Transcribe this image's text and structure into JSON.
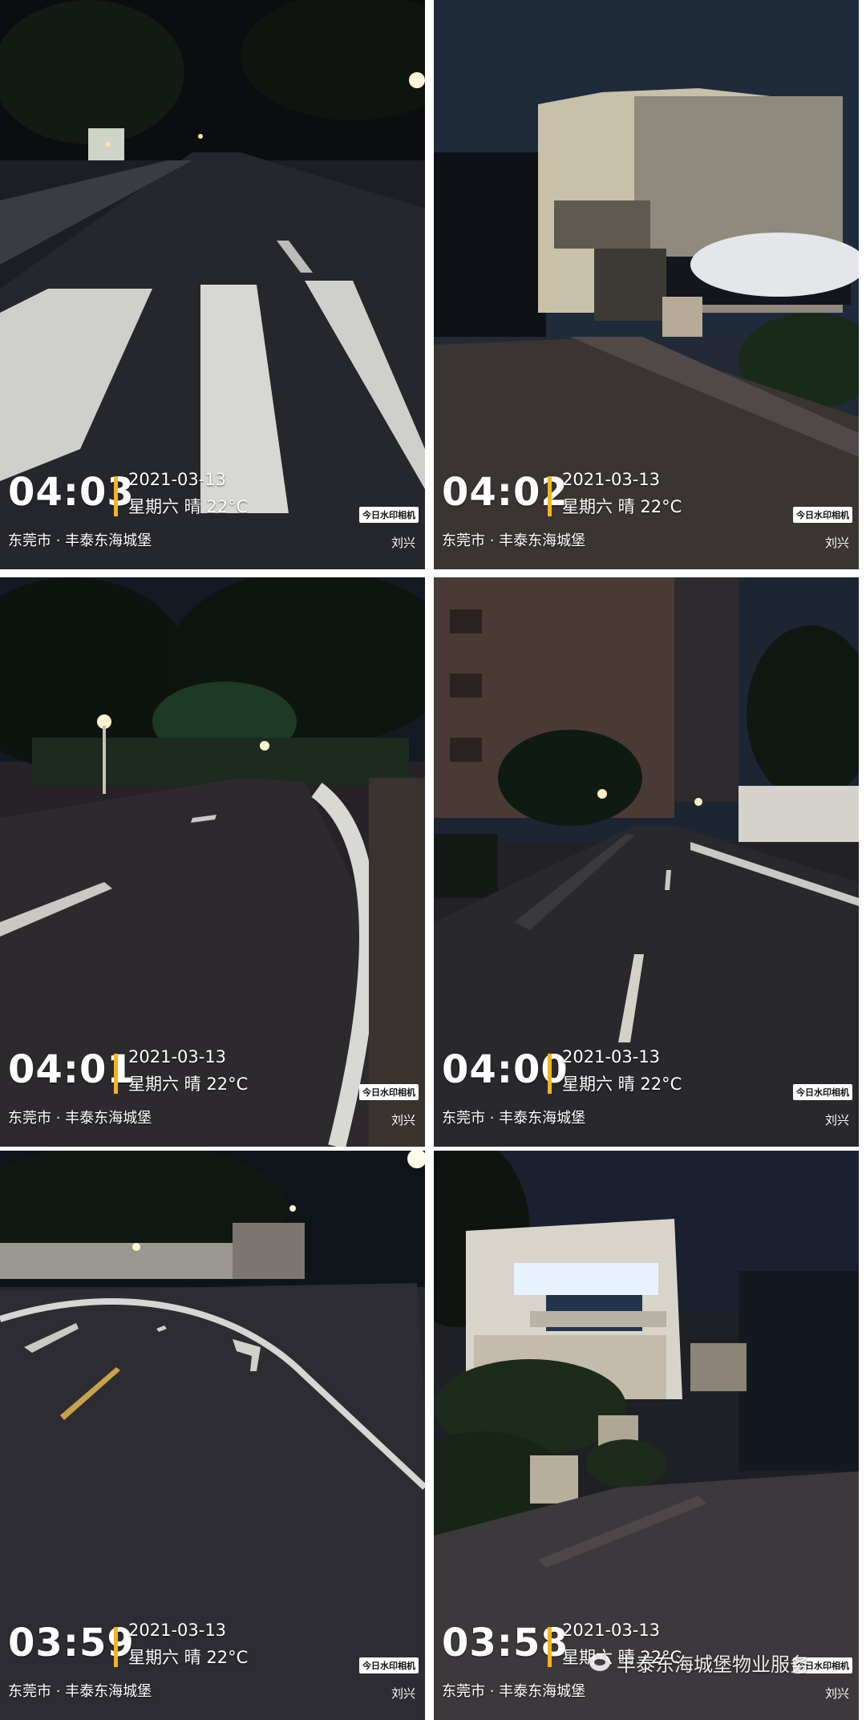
{
  "photos": [
    {
      "time": "04:03",
      "date": "2021-03-13",
      "weekday_weather": "星期六 晴 22°C",
      "location": "东莞市 · 丰泰东海城堡",
      "app": "今日水印相机",
      "user": "刘兴"
    },
    {
      "time": "04:02",
      "date": "2021-03-13",
      "weekday_weather": "星期六 晴 22°C",
      "location": "东莞市 · 丰泰东海城堡",
      "app": "今日水印相机",
      "user": "刘兴"
    },
    {
      "time": "04:01",
      "date": "2021-03-13",
      "weekday_weather": "星期六 晴 22°C",
      "location": "东莞市 · 丰泰东海城堡",
      "app": "今日水印相机",
      "user": "刘兴"
    },
    {
      "time": "04:00",
      "date": "2021-03-13",
      "weekday_weather": "星期六 晴 22°C",
      "location": "东莞市 · 丰泰东海城堡",
      "app": "今日水印相机",
      "user": "刘兴"
    },
    {
      "time": "03:59",
      "date": "2021-03-13",
      "weekday_weather": "星期六 晴 22°C",
      "location": "东莞市 · 丰泰东海城堡",
      "app": "今日水印相机",
      "user": "刘兴"
    },
    {
      "time": "03:58",
      "date": "2021-03-13",
      "weekday_weather": "星期六 晴 22°C",
      "location": "东莞市 · 丰泰东海城堡",
      "app": "今日水印相机",
      "user": "刘兴"
    }
  ],
  "account_watermark": "丰泰东海城堡物业服务",
  "colors": {
    "accent_bar": "#f2b51c",
    "background": "#ffffff"
  }
}
